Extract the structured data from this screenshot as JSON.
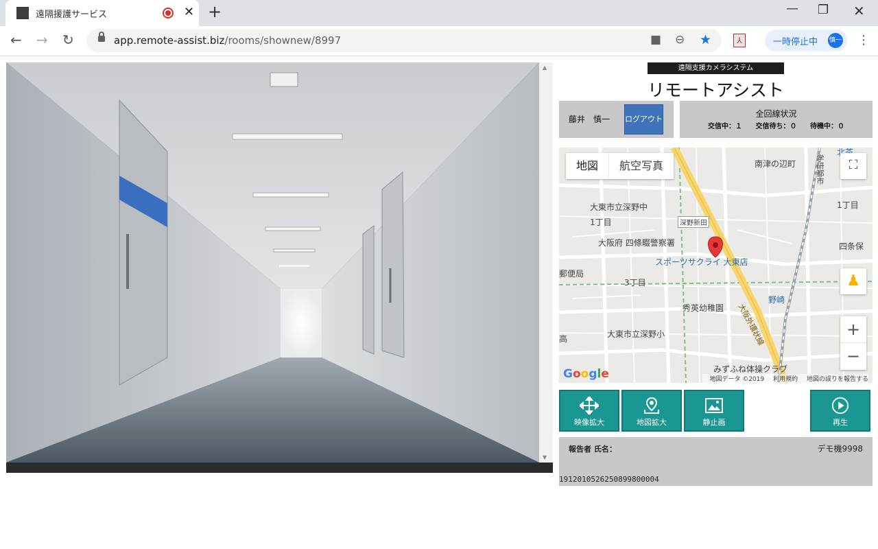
{
  "browser": {
    "tab_title": "遠隔援護サービス",
    "url_host": "app.remote-assist.biz",
    "url_path": "/rooms/shownew/8997",
    "paused_label": "一時停止中",
    "profile_initials": "慎一"
  },
  "header": {
    "system_badge": "遠隔支援カメラシステム",
    "app_title": "リモートアシスト"
  },
  "user": {
    "name": "藤井　慎一",
    "logout_label": "ログアウト"
  },
  "lines": {
    "title": "全回線状況",
    "in_call": "交信中：１",
    "waiting": "交信待ち：０",
    "standby": "待機中：０"
  },
  "map": {
    "type_map": "地図",
    "type_satellite": "航空写真",
    "labels": {
      "nanzu": "南津の辺町",
      "school1": "大東市立深野中",
      "chome1": "1丁目",
      "fukano": "深野新田",
      "police": "大阪府 四條畷警察署",
      "store": "スポーツサクライ 大東店",
      "post": "郵便局",
      "chome3": "3丁目",
      "kindergarten": "秀英幼稚園",
      "nozaki": "野崎",
      "school2": "大東市立深野小",
      "gym": "みずふね体操クラブ",
      "road": "大阪外環状線",
      "chome1r": "1丁目",
      "shijo": "四条保",
      "gakken": "学研都市",
      "kita": "北茶",
      "taka": "高"
    },
    "attribution_data": "地図データ ©2019",
    "attribution_terms": "利用規約",
    "attribution_report": "地図の誤りを報告する"
  },
  "actions": {
    "video_zoom": "映像拡大",
    "map_zoom": "地図拡大",
    "still": "静止画",
    "play": "再生"
  },
  "report": {
    "label": "報告者 氏名：",
    "device": "デモ機9998",
    "id": "1912010526250899800004"
  },
  "colors": {
    "accent_teal": "#1a9792",
    "logout_blue": "#3f74bb",
    "panel_gray": "#c8c8c8",
    "map_pin": "#e53935"
  }
}
